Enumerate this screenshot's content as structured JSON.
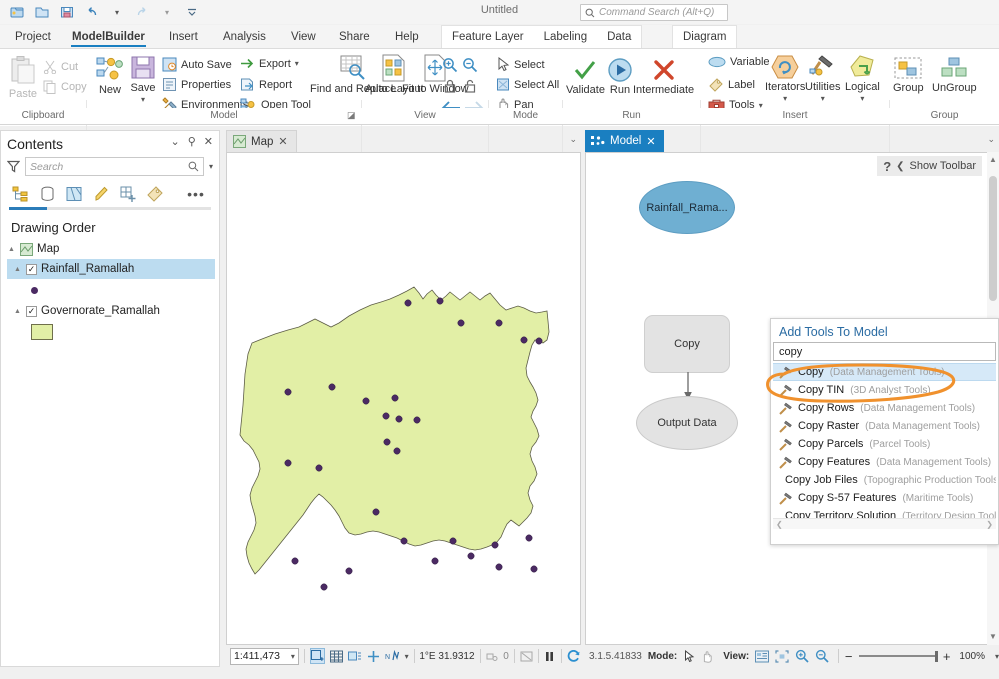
{
  "app": {
    "document_title": "Untitled",
    "command_search_placeholder": "Command Search (Alt+Q)",
    "version": "3.1.5.41833"
  },
  "quick_access": [
    {
      "name": "new-project-icon",
      "label": "New Project"
    },
    {
      "name": "open-project-icon",
      "label": "Open Project"
    },
    {
      "name": "save-project-icon",
      "label": "Save Project"
    },
    {
      "name": "undo-icon",
      "label": "Undo"
    },
    {
      "name": "undo-dropdown-icon",
      "label": "Undo Options"
    },
    {
      "name": "redo-icon",
      "label": "Redo"
    },
    {
      "name": "redo-dropdown-icon",
      "label": "Redo Options"
    },
    {
      "name": "customize-qat-icon",
      "label": "Customize Quick Access Toolbar"
    }
  ],
  "ribbon": {
    "tabs": [
      {
        "label": "Project",
        "active": false
      },
      {
        "label": "ModelBuilder",
        "active": true
      },
      {
        "label": "Insert",
        "active": false
      },
      {
        "label": "Analysis",
        "active": false
      },
      {
        "label": "View",
        "active": false
      },
      {
        "label": "Share",
        "active": false
      },
      {
        "label": "Help",
        "active": false
      }
    ],
    "contextual_tabs": [
      {
        "label": "Feature Layer"
      },
      {
        "label": "Labeling"
      },
      {
        "label": "Data"
      }
    ],
    "contextual_tabs_2": [
      {
        "label": "Diagram"
      }
    ],
    "groups": [
      {
        "label": "Clipboard"
      },
      {
        "label": "Model"
      },
      {
        "label": "View"
      },
      {
        "label": "Mode"
      },
      {
        "label": "Run"
      },
      {
        "label": "Insert"
      },
      {
        "label": "Group"
      }
    ],
    "clipboard": {
      "paste_label": "Paste",
      "cut_label": "Cut",
      "copy_label": "Copy"
    },
    "model": {
      "new_label": "New",
      "save_label": "Save",
      "auto_save_label": "Auto Save",
      "properties_label": "Properties",
      "environments_label": "Environments",
      "export_label": "Export",
      "report_label": "Report",
      "open_tool_label": "Open Tool",
      "find_replace_label": "Find and Replace"
    },
    "view": {
      "auto_layout_label": "Auto Layout",
      "fit_to_window_label": "Fit to Window",
      "zoom_in_label": "Zoom In",
      "zoom_out_label": "Zoom Out",
      "lock_label": "Lock",
      "unlock_label": "Unlock",
      "back_label": "Back",
      "forward_label": "Forward"
    },
    "mode": {
      "select_label": "Select",
      "select_all_label": "Select All",
      "pan_label": "Pan"
    },
    "run": {
      "validate_label": "Validate",
      "run_label": "Run",
      "intermediate_label": "Intermediate"
    },
    "insert": {
      "variable_label": "Variable",
      "label_label": "Label",
      "tools_label": "Tools",
      "iterators_label": "Iterators",
      "utilities_label": "Utilities",
      "logical_label": "Logical"
    },
    "group": {
      "group_label": "Group",
      "ungroup_label": "UnGroup"
    }
  },
  "contents": {
    "title": "Contents",
    "search_placeholder": "Search",
    "section_title": "Drawing Order",
    "toolbar_icons": [
      {
        "name": "list-by-drawing-order-icon"
      },
      {
        "name": "list-by-data-source-icon"
      },
      {
        "name": "list-by-selection-icon"
      },
      {
        "name": "list-by-editing-icon"
      },
      {
        "name": "list-by-snapping-icon"
      },
      {
        "name": "list-by-labeling-icon"
      },
      {
        "name": "more-options-icon"
      }
    ],
    "tree": [
      {
        "label": "Map",
        "type": "map",
        "checked": null,
        "indent": 0
      },
      {
        "label": "Rainfall_Ramallah",
        "type": "point-layer",
        "checked": true,
        "indent": 1,
        "selected": true
      },
      {
        "label": "Governorate_Ramallah",
        "type": "polygon-layer",
        "checked": true,
        "indent": 1,
        "selected": false
      }
    ]
  },
  "map_view": {
    "tab_label": "Map",
    "scale": "1:411,473",
    "coordinates": "1°E 31.9312",
    "selection_count": "0",
    "status_icons": [
      {
        "name": "selection-tool-icon",
        "active": true
      },
      {
        "name": "attribute-table-icon",
        "active": false
      },
      {
        "name": "select-by-attributes-icon",
        "active": false
      },
      {
        "name": "measure-icon",
        "active": false
      },
      {
        "name": "explore-navigation-icon",
        "active": false
      },
      {
        "name": "navigation-dropdown-icon",
        "active": false
      },
      {
        "name": "selected-features-icon",
        "active": false
      },
      {
        "name": "clear-selection-icon",
        "active": false
      },
      {
        "name": "pause-drawing-icon",
        "active": false
      },
      {
        "name": "refresh-icon",
        "active": false
      }
    ]
  },
  "model_view": {
    "tab_label": "Model",
    "show_toolbar_label": "Show Toolbar",
    "nodes": [
      {
        "name": "input-variable-node",
        "label": "Rainfall_Rama...",
        "shape": "ellipse",
        "fill": "#6fafd2"
      },
      {
        "name": "copy-tool-node",
        "label": "Copy",
        "shape": "rounded-rect",
        "fill": "#e3e3e3"
      },
      {
        "name": "output-data-node",
        "label": "Output Data",
        "shape": "ellipse",
        "fill": "#e3e3e3"
      }
    ],
    "status": {
      "version": "3.1.5.41833",
      "mode_label": "Mode:",
      "view_label": "View:",
      "zoom_level": "100%",
      "mode_icons": [
        {
          "name": "select-mode-icon",
          "active": true
        },
        {
          "name": "pan-mode-icon",
          "active": false
        }
      ],
      "view_icons": [
        {
          "name": "diagram-view-icon",
          "active": false
        },
        {
          "name": "fit-to-window-icon",
          "active": false
        },
        {
          "name": "zoom-in-icon",
          "active": false
        },
        {
          "name": "zoom-out-icon",
          "active": false
        }
      ]
    }
  },
  "add_tools_dialog": {
    "title": "Add Tools To Model",
    "search_value": "copy",
    "results": [
      {
        "name": "Copy",
        "source": "(Data Management Tools)",
        "icon": "tool-hammer-icon",
        "selected": true
      },
      {
        "name": "Copy TIN",
        "source": "(3D Analyst Tools)",
        "icon": "tool-hammer-icon",
        "selected": false
      },
      {
        "name": "Copy Rows",
        "source": "(Data Management Tools)",
        "icon": "tool-hammer-icon",
        "selected": false
      },
      {
        "name": "Copy Raster",
        "source": "(Data Management Tools)",
        "icon": "tool-hammer-icon",
        "selected": false
      },
      {
        "name": "Copy Parcels",
        "source": "(Parcel Tools)",
        "icon": "tool-hammer-icon",
        "selected": false
      },
      {
        "name": "Copy Features",
        "source": "(Data Management Tools)",
        "icon": "tool-hammer-icon",
        "selected": false
      },
      {
        "name": "Copy Job Files",
        "source": "(Topographic Production Tools)",
        "icon": "tool-book-icon",
        "selected": false
      },
      {
        "name": "Copy S-57 Features",
        "source": "(Maritime Tools)",
        "icon": "tool-hammer-icon",
        "selected": false
      },
      {
        "name": "Copy Territory Solution",
        "source": "(Territory Design Tools)",
        "icon": "tool-hammer-icon",
        "selected": false
      }
    ]
  },
  "colors": {
    "accent": "#1a7fc1",
    "selection": "#bcdcf0",
    "annotation": "#f0912d",
    "polygon_fill": "#e2efa6",
    "point_symbol": "#4b2a63",
    "node_blue": "#6fafd2",
    "node_grey": "#e3e3e3"
  }
}
